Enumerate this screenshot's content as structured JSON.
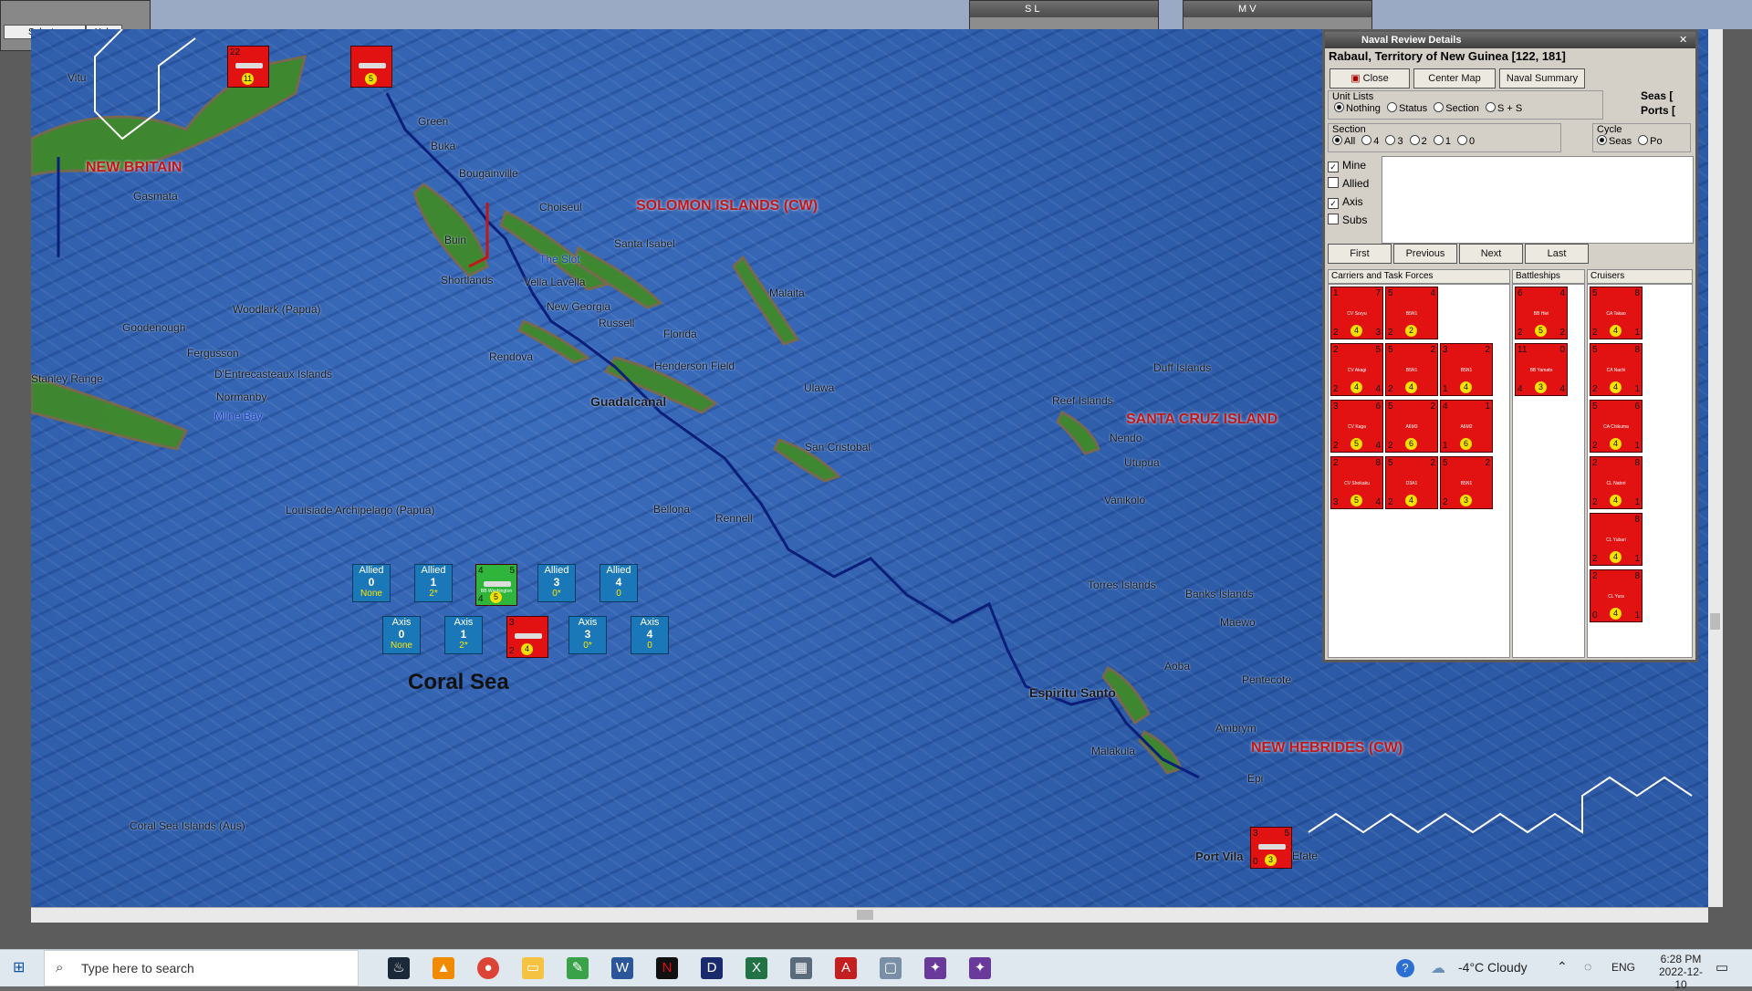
{
  "top_menu": {
    "select": "Select",
    "help": "Help"
  },
  "mini_windows": [
    {
      "title": "S L"
    },
    {
      "title": "M V"
    }
  ],
  "map": {
    "regions": [
      {
        "id": "new-britain",
        "text": "NEW BRITAIN"
      },
      {
        "id": "solomon",
        "text": "SOLOMON ISLANDS (CW)"
      },
      {
        "id": "santa-cruz",
        "text": "SANTA CRUZ ISLAND"
      },
      {
        "id": "new-hebrides",
        "text": "NEW HEBRIDES (CW)"
      }
    ],
    "sea_name": "Coral Sea",
    "places": {
      "vitu": "Vitu",
      "gasmata": "Gasmata",
      "green": "Green",
      "buka": "Buka",
      "bougainville": "Bougainville",
      "choiseul": "Choiseul",
      "santa_isabel": "Santa Isabel",
      "buin": "Buin",
      "the_slot": "The Slot",
      "shortlands": "Shortlands",
      "vella_lavella": "Vella Lavella",
      "new_georgia": "New Georgia",
      "russell": "Russell",
      "florida": "Florida",
      "rendova": "Rendova",
      "henderson": "Henderson Field",
      "guadalcanal": "Guadalcanal",
      "malaita": "Malaita",
      "ulawa": "Ulawa",
      "san_cristobal": "San Cristobal",
      "woodlark": "Woodlark (Papua)",
      "goodenough": "Goodenough",
      "fergusson": "Fergusson",
      "dentrecasteaux": "D'Entrecasteaux Islands",
      "normanby": "Normanby",
      "milne_bay": "Milne Bay",
      "stanley": "Stanley Range",
      "louisiade": "Louisiade Archipelago (Papua)",
      "bellona": "Bellona",
      "rennell": "Rennell",
      "duff": "Duff Islands",
      "reef": "Reef Islands",
      "nendo": "Nendo",
      "utupua": "Utupua",
      "vanikolo": "Vanikolo",
      "torres": "Torres Islands",
      "banks": "Banks Islands",
      "maewo": "Maewo",
      "aoba": "Aoba",
      "pentecote": "Pentecote",
      "espiritu": "Espiritu Santo",
      "ambrym": "Ambrym",
      "malakula": "Malakula",
      "epi": "Epi",
      "port_vila": "Port Vila",
      "efate": "Efate",
      "coral_sea_islands": "Coral Sea Islands (Aus)"
    },
    "counters": [
      {
        "id": "rabaul-air",
        "tl": "22",
        "dot": "11",
        "color": "red"
      },
      {
        "id": "green-air",
        "dot": "5",
        "color": "red"
      },
      {
        "id": "coral-allied",
        "tl": "4",
        "tr": "5",
        "bl": "4",
        "dot": "5",
        "cap": "BB Washington",
        "color": "green"
      },
      {
        "id": "coral-axis",
        "tl": "3",
        "bl": "2",
        "dot": "4",
        "color": "red"
      },
      {
        "id": "efate-axis",
        "tl": "3",
        "tr": "5",
        "bl": "0",
        "dot": "3",
        "color": "red"
      }
    ],
    "allied_boxes": [
      {
        "label": "Allied",
        "value": "0",
        "sub": "None"
      },
      {
        "label": "Allied",
        "value": "1",
        "sub": "2*"
      },
      {
        "label": "Allied",
        "value": "3",
        "sub": "0*"
      },
      {
        "label": "Allied",
        "value": "4",
        "sub": "0"
      }
    ],
    "axis_boxes": [
      {
        "label": "Axis",
        "value": "0",
        "sub": "None"
      },
      {
        "label": "Axis",
        "value": "1",
        "sub": "2*"
      },
      {
        "label": "Axis",
        "value": "3",
        "sub": "0*"
      },
      {
        "label": "Axis",
        "value": "4",
        "sub": "0"
      }
    ]
  },
  "panel": {
    "title": "Naval Review Details",
    "location": "Rabaul, Territory of New Guinea [122, 181]",
    "buttons": {
      "close": "Close",
      "center": "Center Map",
      "summary": "Naval Summary"
    },
    "right_labels": {
      "seas": "Seas [",
      "ports": "Ports ["
    },
    "unit_lists": {
      "label": "Unit Lists",
      "options": [
        "Nothing",
        "Status",
        "Section",
        "S + S"
      ],
      "selected": "Nothing"
    },
    "section": {
      "label": "Section",
      "options": [
        "All",
        "4",
        "3",
        "2",
        "1",
        "0"
      ],
      "selected": "All"
    },
    "cycle": {
      "label": "Cycle",
      "options": [
        "Seas",
        "Po"
      ],
      "selected": "Seas"
    },
    "filters": [
      {
        "label": "Mine",
        "checked": true
      },
      {
        "label": "Allied",
        "checked": false
      },
      {
        "label": "Axis",
        "checked": true
      },
      {
        "label": "Subs",
        "checked": false
      }
    ],
    "nav": {
      "first": "First",
      "previous": "Previous",
      "next": "Next",
      "last": "Last"
    },
    "columns": {
      "carriers": "Carriers and Task Forces",
      "battleships": "Battleships",
      "cruisers": "Cruisers"
    },
    "carrier_units": [
      {
        "tl": "1",
        "tc": "6",
        "tr": "7",
        "cap": "CV Soryu",
        "bl": "2",
        "bc": "4",
        "br": "3"
      },
      {
        "tl": "5",
        "tc": "1",
        "tr": "4",
        "cap": "B5N1",
        "bl": "2",
        "bc": "2",
        "br": ""
      },
      {
        "tl": "2",
        "tc": "5",
        "tr": "5",
        "cap": "CV Akagi",
        "bl": "2",
        "bc": "4",
        "br": "4"
      },
      {
        "tl": "5",
        "tc": "2",
        "tr": "",
        "cap": "B5N1",
        "bl": "2",
        "bc": "4",
        "br": ""
      },
      {
        "tl": "3",
        "tc": "2",
        "tr": "",
        "cap": "B5N1",
        "bl": "1",
        "bc": "4",
        "br": ""
      },
      {
        "tl": "3",
        "tc": "5",
        "tr": "6",
        "cap": "CV Kaga",
        "bl": "2",
        "bc": "5",
        "br": "4"
      },
      {
        "tl": "5",
        "tc": "2",
        "tr": "",
        "cap": "A6M3",
        "bl": "2",
        "bc": "6",
        "br": ""
      },
      {
        "tl": "4",
        "tc": "1",
        "tr": "",
        "cap": "A6M2",
        "bl": "1",
        "bc": "6",
        "br": ""
      },
      {
        "tl": "2",
        "tc": "6",
        "tr": "8",
        "cap": "CV Shokaku",
        "bl": "3",
        "bc": "5",
        "br": "4"
      },
      {
        "tl": "5",
        "tc": "2",
        "tr": "",
        "cap": "D3A1",
        "bl": "2",
        "bc": "4",
        "br": ""
      },
      {
        "tl": "5",
        "tc": "2",
        "tr": "",
        "cap": "B5N1",
        "bl": "2",
        "bc": "3",
        "br": ""
      }
    ],
    "battleship_units": [
      {
        "tl": "6",
        "tc": "5",
        "tr": "4",
        "cap": "BB Hiei",
        "bl": "2",
        "bc": "5",
        "br": "2"
      },
      {
        "tl": "11",
        "tc": "5",
        "tr": "0",
        "cap": "BB Yamato",
        "bl": "4",
        "bc": "3",
        "br": "4"
      }
    ],
    "cruiser_units": [
      {
        "tl": "5",
        "tc": "6",
        "tr": "8",
        "cap": "CA Takao",
        "bl": "2",
        "bc": "4",
        "br": "1"
      },
      {
        "tl": "5",
        "tc": "6",
        "tr": "8",
        "cap": "CA Nachi",
        "bl": "2",
        "bc": "4",
        "br": "1"
      },
      {
        "tl": "5",
        "tc": "6",
        "tr": "6",
        "cap": "CA Chikuma",
        "bl": "2",
        "bc": "4",
        "br": "1"
      },
      {
        "tl": "2",
        "tc": "6",
        "tr": "8",
        "cap": "CL Natori",
        "bl": "2",
        "bc": "4",
        "br": "1"
      },
      {
        "tl": "",
        "tc": "6",
        "tr": "8",
        "cap": "CL Yubari",
        "bl": "2",
        "bc": "4",
        "br": "1"
      },
      {
        "tl": "2",
        "tc": "6",
        "tr": "8",
        "cap": "CL Yura",
        "bl": "0",
        "bc": "4",
        "br": "1"
      }
    ]
  },
  "taskbar": {
    "search_placeholder": "Type here to search",
    "weather": "-4°C  Cloudy",
    "lang": "ENG",
    "time": "6:28 PM",
    "date": "2022-12-10"
  },
  "colors": {
    "axis": "#e31212",
    "allied_green": "#2fb43c",
    "box_blue": "#1a78b8",
    "region_red": "#c01818"
  }
}
